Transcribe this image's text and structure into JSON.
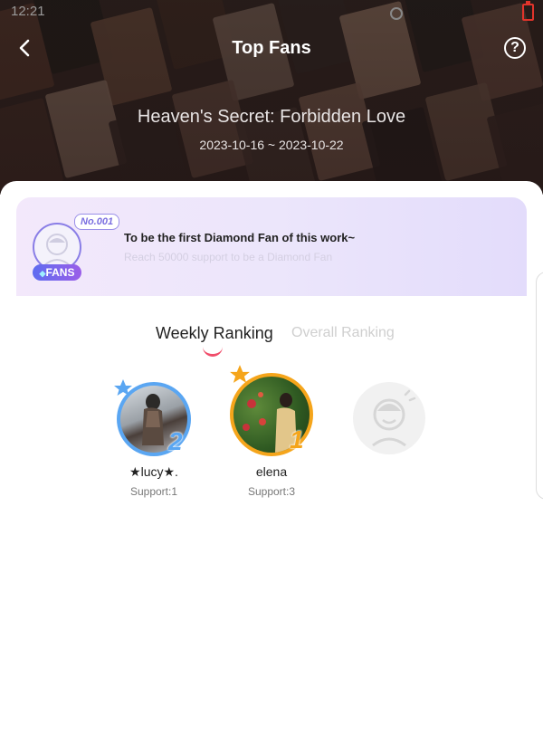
{
  "status": {
    "time": "12:21"
  },
  "header": {
    "title": "Top Fans",
    "help_symbol": "?"
  },
  "work": {
    "title": "Heaven's Secret: Forbidden Love",
    "date_range": "2023-10-16 ~ 2023-10-22"
  },
  "banner": {
    "badge_number": "No.001",
    "fans_tag": "FANS",
    "headline": "To be the first Diamond Fan of this work~",
    "subtext": "Reach 50000 support to be a Diamond Fan"
  },
  "tabs": {
    "weekly": "Weekly Ranking",
    "overall": "Overall Ranking",
    "active": "weekly"
  },
  "podium": [
    {
      "rank": "2",
      "name": "★lucy★.",
      "support": "Support:1",
      "ring_color": "#5aa6f2"
    },
    {
      "rank": "1",
      "name": "elena",
      "support": "Support:3",
      "ring_color": "#f5a51b"
    },
    {
      "rank": "3",
      "name": "",
      "support": "",
      "ring_color": "#eeeeee"
    }
  ]
}
